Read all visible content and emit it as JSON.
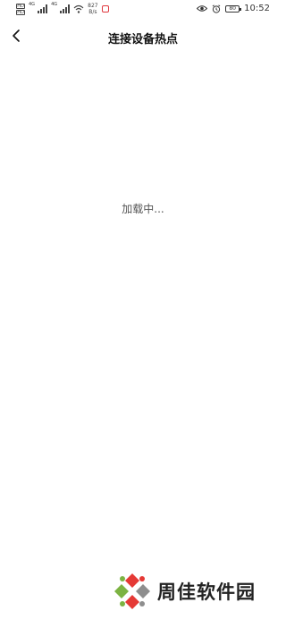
{
  "status_bar": {
    "sim1_tag": "HD",
    "sim2_tag": "HD",
    "net1": "4G",
    "net2": "4G",
    "speed_value": "827",
    "speed_unit": "B/s",
    "battery": "80",
    "time": "10:52",
    "icons": [
      "hd-icon",
      "signal-icon",
      "wifi-icon",
      "app-notification-icon",
      "eye-icon",
      "alarm-icon",
      "battery-icon"
    ]
  },
  "nav": {
    "title": "连接设备热点",
    "back_icon": "chevron-left-icon"
  },
  "content": {
    "loading": "加载中..."
  },
  "watermark": {
    "text": "周佳软件园",
    "colors": [
      "#e53935",
      "#7cb342",
      "#8e8e8e"
    ]
  }
}
